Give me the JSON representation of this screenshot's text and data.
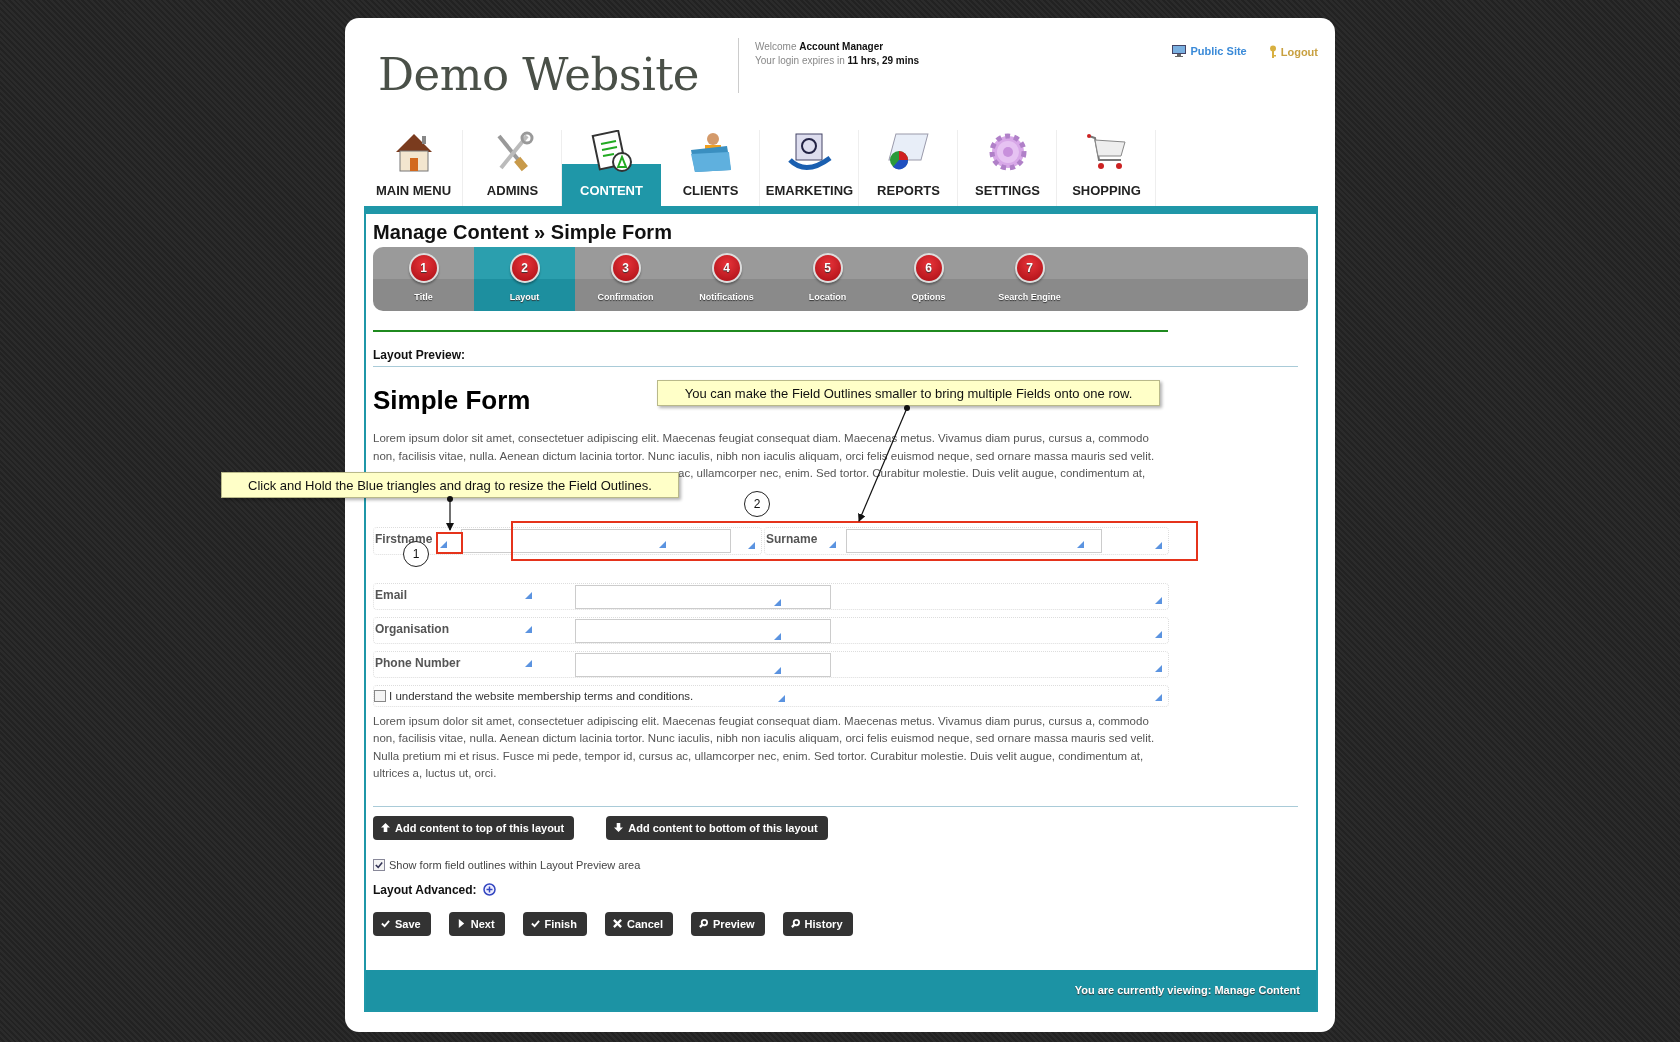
{
  "header": {
    "site_title": "Demo Website",
    "welcome_label": "Welcome",
    "user": "Account Manager",
    "expires_label": "Your login expires in",
    "expires_value": "11 hrs, 29 mins",
    "links": [
      "Public Site",
      "Logout"
    ]
  },
  "nav": [
    {
      "label": "MAIN MENU",
      "selected": false
    },
    {
      "label": "ADMINS",
      "selected": false
    },
    {
      "label": "CONTENT",
      "selected": true
    },
    {
      "label": "CLIENTS",
      "selected": false
    },
    {
      "label": "EMARKETING",
      "selected": false
    },
    {
      "label": "REPORTS",
      "selected": false
    },
    {
      "label": "SETTINGS",
      "selected": false
    },
    {
      "label": "SHOPPING",
      "selected": false
    }
  ],
  "page_title": "Manage Content » Simple Form",
  "steps": [
    {
      "number": "1",
      "label": "Title",
      "selected": false
    },
    {
      "number": "2",
      "label": "Layout",
      "selected": true
    },
    {
      "number": "3",
      "label": "Confirmation",
      "selected": false
    },
    {
      "number": "4",
      "label": "Notifications",
      "selected": false
    },
    {
      "number": "5",
      "label": "Location",
      "selected": false
    },
    {
      "number": "6",
      "label": "Options",
      "selected": false
    },
    {
      "number": "7",
      "label": "Search Engine",
      "selected": false
    }
  ],
  "layout_preview": {
    "heading": "Layout Preview:",
    "form_title": "Simple Form",
    "intro_lines": [
      "Lorem ipsum dolor sit amet, consectetuer adipiscing elit. Maecenas feugiat consequat diam. Maecenas metus. Vivamus diam purus, cursus a, commodo",
      "non, facilisis vitae, nulla. Aenean dictum lacinia tortor. Nunc iaculis, nibh non iaculis aliquam, orci felis euismod neque, sed ornare massa mauris sed velit.",
      "ac, ullamcorper nec, enim. Sed tortor. Curabitur molestie. Duis velit augue, condimentum at,"
    ],
    "rows": [
      {
        "kind": "pair",
        "fields": [
          {
            "label": "Firstname"
          },
          {
            "label": "Surname"
          }
        ]
      },
      {
        "kind": "single",
        "label": "Email"
      },
      {
        "kind": "single",
        "label": "Organisation"
      },
      {
        "kind": "single",
        "label": "Phone Number"
      },
      {
        "kind": "checkbox",
        "label": "I understand the website membership terms and conditions.",
        "checked": false
      }
    ],
    "closing_text": "Lorem ipsum dolor sit amet, consectetuer adipiscing elit. Maecenas feugiat consequat diam. Maecenas metus. Vivamus diam purus, cursus a, commodo non, facilisis vitae, nulla. Aenean dictum lacinia tortor. Nunc iaculis, nibh non iaculis aliquam, orci felis euismod neque, sed ornare massa mauris sed velit. Nulla pretium mi et risus. Fusce mi pede, tempor id, cursus ac, ullamcorper nec, enim. Sed tortor. Curabitur molestie. Duis velit augue, condimentum at, ultrices a, luctus ut, orci."
  },
  "callouts": [
    {
      "text": "You can make the Field Outlines smaller to bring multiple Fields onto one row."
    },
    {
      "text": "Click and Hold the Blue triangles and drag to resize the Field Outlines."
    }
  ],
  "markers": [
    "1",
    "2"
  ],
  "layout_actions": [
    "Add content to top of this layout",
    "Add content to bottom of this layout"
  ],
  "show_outlines": {
    "label": "Show form field outlines within Layout Preview area",
    "checked": true
  },
  "layout_advanced": {
    "label": "Layout Advanced:",
    "expanded": false
  },
  "actions": [
    "Save",
    "Next",
    "Finish",
    "Cancel",
    "Preview",
    "History"
  ],
  "footer": "You are currently viewing: Manage Content"
}
